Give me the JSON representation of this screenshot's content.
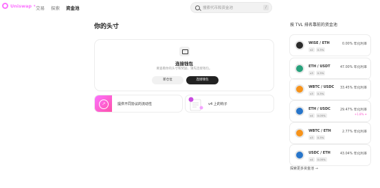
{
  "brand": {
    "name": "Uniswap",
    "caret": "▾",
    "color": "#fc72ff"
  },
  "nav": {
    "items": [
      "交易",
      "探索",
      "资金池"
    ],
    "active": "资金池"
  },
  "search": {
    "placeholder": "搜索代币和资金池",
    "shortcut": "/"
  },
  "main": {
    "title": "你的头寸",
    "wallet_card": {
      "title": "连接钱包",
      "subtitle": "要查看你的头寸和奖励，请先连接钱包。",
      "secondary_label": "新仓位",
      "primary_label": "连接钱包"
    },
    "promos": [
      {
        "text": "提供不同协议的流动性"
      },
      {
        "text": "v4 上的钩子"
      }
    ]
  },
  "sidebar": {
    "title": "按 TVL 排名靠前的资金池",
    "pools": [
      {
        "name": "WISE / ETH",
        "apr": "0.00% 年化利率",
        "version": "v2",
        "fee": "0.3%",
        "logo_color": "#2b2b2b"
      },
      {
        "name": "ETH / USDT",
        "apr": "47.00% 年化利率",
        "version": "v3",
        "fee": "0.3%",
        "logo_color": "#26a17b"
      },
      {
        "name": "WBTC / USDC",
        "apr": "33.45% 年化利率",
        "version": "v3",
        "fee": "0.3%",
        "logo_color": "#f7931a"
      },
      {
        "name": "ETH / USDC",
        "apr": "29.47% 年化利率",
        "apr_extra": "+1.8% ✦",
        "version": "v4",
        "fee": "0.05%",
        "logo_color": "#2775ca"
      },
      {
        "name": "WBTC / ETH",
        "apr": "2.77% 年化利率",
        "version": "v3",
        "fee": "0.3%",
        "logo_color": "#f7931a"
      },
      {
        "name": "USDC / ETH",
        "apr": "43.04% 年化利率",
        "version": "v4",
        "fee": "0.05%",
        "logo_color": "#2775ca"
      }
    ],
    "explore_label": "探索更多资金池 →"
  }
}
